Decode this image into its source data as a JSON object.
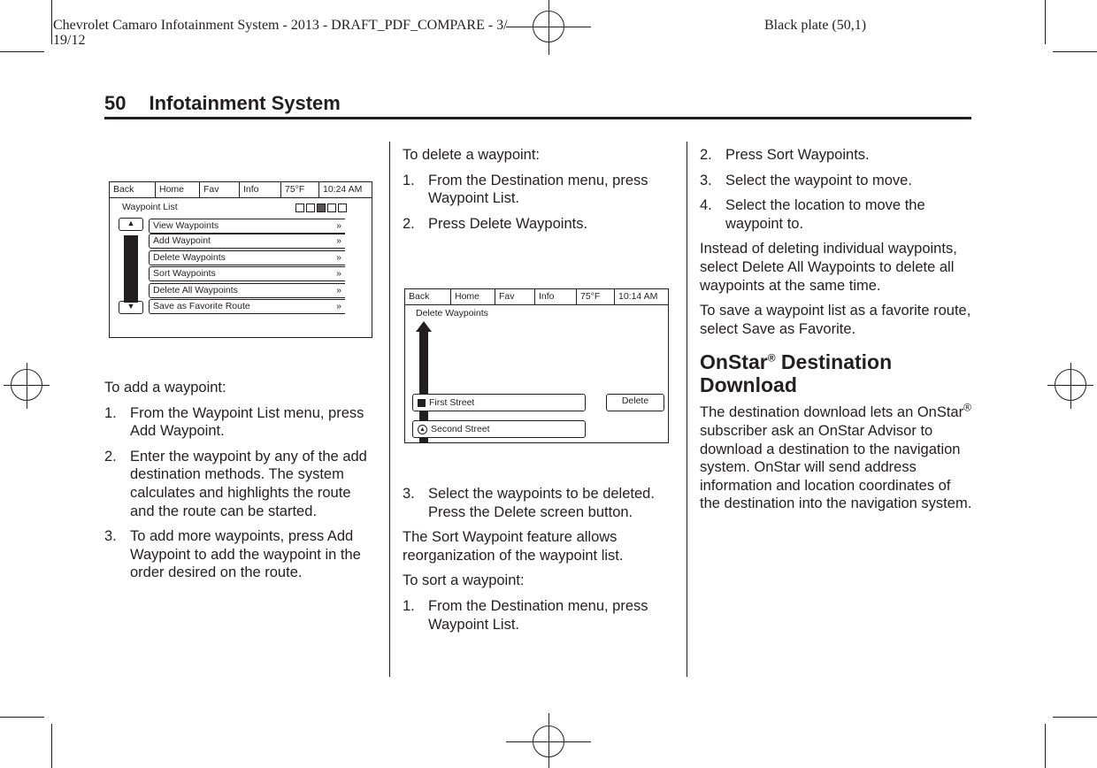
{
  "print_header": {
    "job": "Chevrolet Camaro Infotainment System - 2013 - DRAFT_PDF_COMPARE - 3/",
    "date": "19/12",
    "plate": "Black plate (50,1)"
  },
  "page": {
    "number": "50",
    "section": "Infotainment System"
  },
  "screen1": {
    "tabs": [
      "Back",
      "Home",
      "Fav",
      "Info",
      "75°F",
      "10:24 AM"
    ],
    "title": "Waypoint List",
    "items": [
      "View Waypoints",
      "Add Waypoint",
      "Delete Waypoints",
      "Sort Waypoints",
      "Delete All Waypoints",
      "Save as Favorite Route"
    ]
  },
  "screen2": {
    "tabs": [
      "Back",
      "Home",
      "Fav",
      "Info",
      "75°F",
      "10:14 AM"
    ],
    "title": "Delete Waypoints",
    "waypoints": [
      "First Street",
      "Second Street"
    ],
    "delete": "Delete"
  },
  "col1": {
    "intro": "To add a waypoint:",
    "steps": [
      {
        "n": "1.",
        "t": "From the Waypoint List menu, press Add Waypoint."
      },
      {
        "n": "2.",
        "t": "Enter the waypoint by any of the add destination methods. The system calculates and highlights the route and the route can be started."
      },
      {
        "n": "3.",
        "t": "To add more waypoints, press Add Waypoint to add the waypoint in the order desired on the route."
      }
    ]
  },
  "col2": {
    "intro": "To delete a waypoint:",
    "steps": [
      {
        "n": "1.",
        "t": "From the Destination menu, press Waypoint List."
      },
      {
        "n": "2.",
        "t": "Press Delete Waypoints."
      },
      {
        "n": "3.",
        "t": "Select the waypoints to be deleted. Press the Delete screen button."
      }
    ],
    "p1": "The Sort Waypoint feature allows reorganization of the waypoint list.",
    "p2": "To sort a waypoint:",
    "sort_steps": [
      {
        "n": "1.",
        "t": "From the Destination menu, press Waypoint List."
      }
    ]
  },
  "col3": {
    "steps": [
      {
        "n": "2.",
        "t": "Press Sort Waypoints."
      },
      {
        "n": "3.",
        "t": "Select the waypoint to move."
      },
      {
        "n": "4.",
        "t": "Select the location to move the waypoint to."
      }
    ],
    "p1": "Instead of deleting individual waypoints, select Delete All Waypoints to delete all waypoints at the same time.",
    "p2": "To save a waypoint list as a favorite route, select Save as Favorite.",
    "heading_a": "OnStar",
    "heading_reg": "®",
    "heading_b": " Destination Download",
    "p3a": "The destination download lets an OnStar",
    "p3reg": "®",
    "p3b": " subscriber ask an OnStar Advisor to download a destination to the navigation system. OnStar will send address information and location coordinates of the destination into the navigation system."
  }
}
